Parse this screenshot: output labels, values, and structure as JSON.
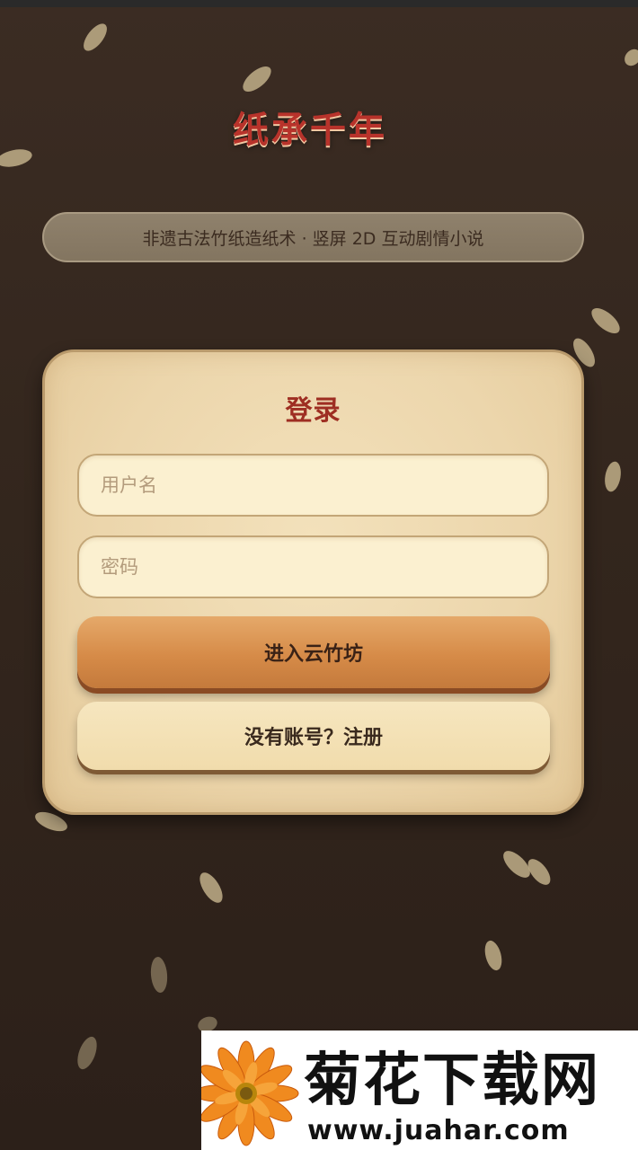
{
  "app": {
    "title": "纸承千年",
    "subtitle": "非遗古法竹纸造纸术 · 竖屏 2D 互动剧情小说"
  },
  "login": {
    "heading": "登录",
    "username_placeholder": "用户名",
    "password_placeholder": "密码",
    "submit_label": "进入云竹坊",
    "register_label": "没有账号？注册"
  },
  "watermark": {
    "brand": "菊花下载网",
    "url": "www.juahar.com"
  },
  "colors": {
    "background": "#33261d",
    "title_red": "#b8332b",
    "card": "#ecd6ac",
    "primary_button": "#d68b48",
    "secondary_button": "#f1dcac"
  },
  "icons": {
    "decoration": "falling-petal-icon",
    "watermark_logo": "flower-logo-icon"
  }
}
